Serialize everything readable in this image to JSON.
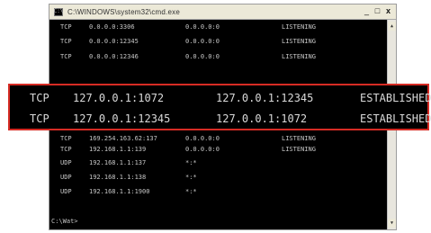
{
  "window": {
    "title": "C:\\WINDOWS\\system32\\cmd.exe",
    "controls": {
      "minimize": "_",
      "maximize": "□",
      "close": "x"
    }
  },
  "console": {
    "rows": [
      {
        "proto": "TCP",
        "local": "0.0.0.0:3306",
        "foreign": "0.0.0.0:0",
        "state": "LISTENING"
      },
      {
        "proto": "TCP",
        "local": "0.0.0.0:12345",
        "foreign": "0.0.0.0:0",
        "state": "LISTENING"
      },
      {
        "proto": "TCP",
        "local": "0.0.0.0:12346",
        "foreign": "0.0.0.0:0",
        "state": "LISTENING"
      },
      {
        "proto": "TCP",
        "local": "169.254.163.62:137",
        "foreign": "0.0.0.0:0",
        "state": "LISTENING"
      },
      {
        "proto": "TCP",
        "local": "192.168.1.1:139",
        "foreign": "0.0.0.0:0",
        "state": "LISTENING"
      },
      {
        "proto": "UDP",
        "local": "192.168.1.1:137",
        "foreign": "*:*",
        "state": ""
      },
      {
        "proto": "UDP",
        "local": "192.168.1.1:138",
        "foreign": "*:*",
        "state": ""
      },
      {
        "proto": "UDP",
        "local": "192.168.1.1:1900",
        "foreign": "*:*",
        "state": ""
      }
    ],
    "prompt": "C:\\Wat>"
  },
  "highlight": {
    "rows": [
      {
        "proto": "TCP",
        "local": "127.0.0.1:1072",
        "foreign": "127.0.0.1:12345",
        "state": "ESTABLISHED"
      },
      {
        "proto": "TCP",
        "local": "127.0.0.1:12345",
        "foreign": "127.0.0.1:1072",
        "state": "ESTABLISHED"
      }
    ],
    "border_color": "#d62b24"
  }
}
